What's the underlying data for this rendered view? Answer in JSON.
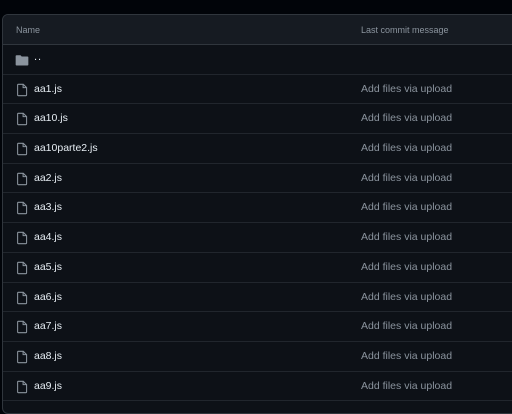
{
  "table": {
    "header": {
      "name_label": "Name",
      "message_label": "Last commit message"
    },
    "parent": {
      "label": "..",
      "icon": "folder-icon"
    },
    "files": [
      {
        "name": "aa1.js",
        "message": "Add files via upload"
      },
      {
        "name": "aa10.js",
        "message": "Add files via upload"
      },
      {
        "name": "aa10parte2.js",
        "message": "Add files via upload"
      },
      {
        "name": "aa2.js",
        "message": "Add files via upload"
      },
      {
        "name": "aa3.js",
        "message": "Add files via upload"
      },
      {
        "name": "aa4.js",
        "message": "Add files via upload"
      },
      {
        "name": "aa5.js",
        "message": "Add files via upload"
      },
      {
        "name": "aa6.js",
        "message": "Add files via upload"
      },
      {
        "name": "aa7.js",
        "message": "Add files via upload"
      },
      {
        "name": "aa8.js",
        "message": "Add files via upload"
      },
      {
        "name": "aa9.js",
        "message": "Add files via upload"
      }
    ]
  },
  "colors": {
    "background": "#010409",
    "panel": "#0d1117",
    "header": "#161b22",
    "border": "#30363d",
    "text": "#e6edf3",
    "muted": "#8b949e"
  }
}
